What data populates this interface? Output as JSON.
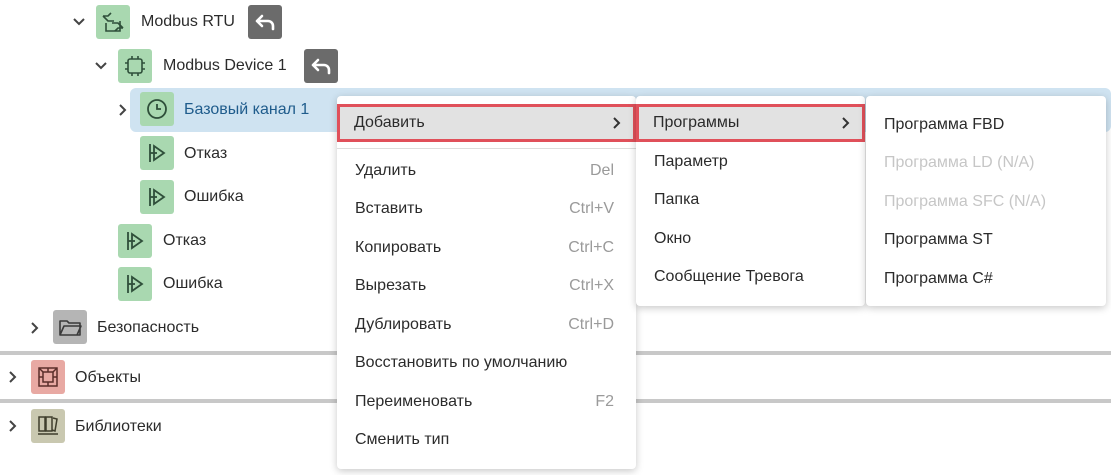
{
  "tree": {
    "modbus_rtu": {
      "label": "Modbus RTU"
    },
    "modbus_device": {
      "label": "Modbus Device 1"
    },
    "base_channel": {
      "label": "Базовый канал 1"
    },
    "child_fault": {
      "label": "Отказ"
    },
    "child_error": {
      "label": "Ошибка"
    },
    "device_fault": {
      "label": "Отказ"
    },
    "device_error": {
      "label": "Ошибка"
    },
    "security": {
      "label": "Безопасность"
    }
  },
  "panels": {
    "objects": {
      "label": "Объекты"
    },
    "libraries": {
      "label": "Библиотеки"
    }
  },
  "context_menu": {
    "add": "Добавить",
    "delete": {
      "label": "Удалить",
      "shortcut": "Del"
    },
    "paste": {
      "label": "Вставить",
      "shortcut": "Ctrl+V"
    },
    "copy": {
      "label": "Копировать",
      "shortcut": "Ctrl+C"
    },
    "cut": {
      "label": "Вырезать",
      "shortcut": "Ctrl+X"
    },
    "duplicate": {
      "label": "Дублировать",
      "shortcut": "Ctrl+D"
    },
    "restore_default": {
      "label": "Восстановить по умолчанию"
    },
    "rename": {
      "label": "Переименовать",
      "shortcut": "F2"
    },
    "change_type": {
      "label": "Сменить тип"
    }
  },
  "add_submenu": {
    "programs": "Программы",
    "parameter": "Параметр",
    "folder": "Папка",
    "window": "Окно",
    "alarm_message": "Сообщение Тревога"
  },
  "programs_submenu": {
    "fbd": "Программа FBD",
    "ld": "Программа LD (N/A)",
    "sfc": "Программа SFC (N/A)",
    "st": "Программа ST",
    "csharp": "Программа C#"
  },
  "colors": {
    "selection": "#cfe3f1",
    "active_outline": "#e0505a",
    "link_text": "#1f5c8c",
    "green_icon": "#a9d8b0"
  }
}
